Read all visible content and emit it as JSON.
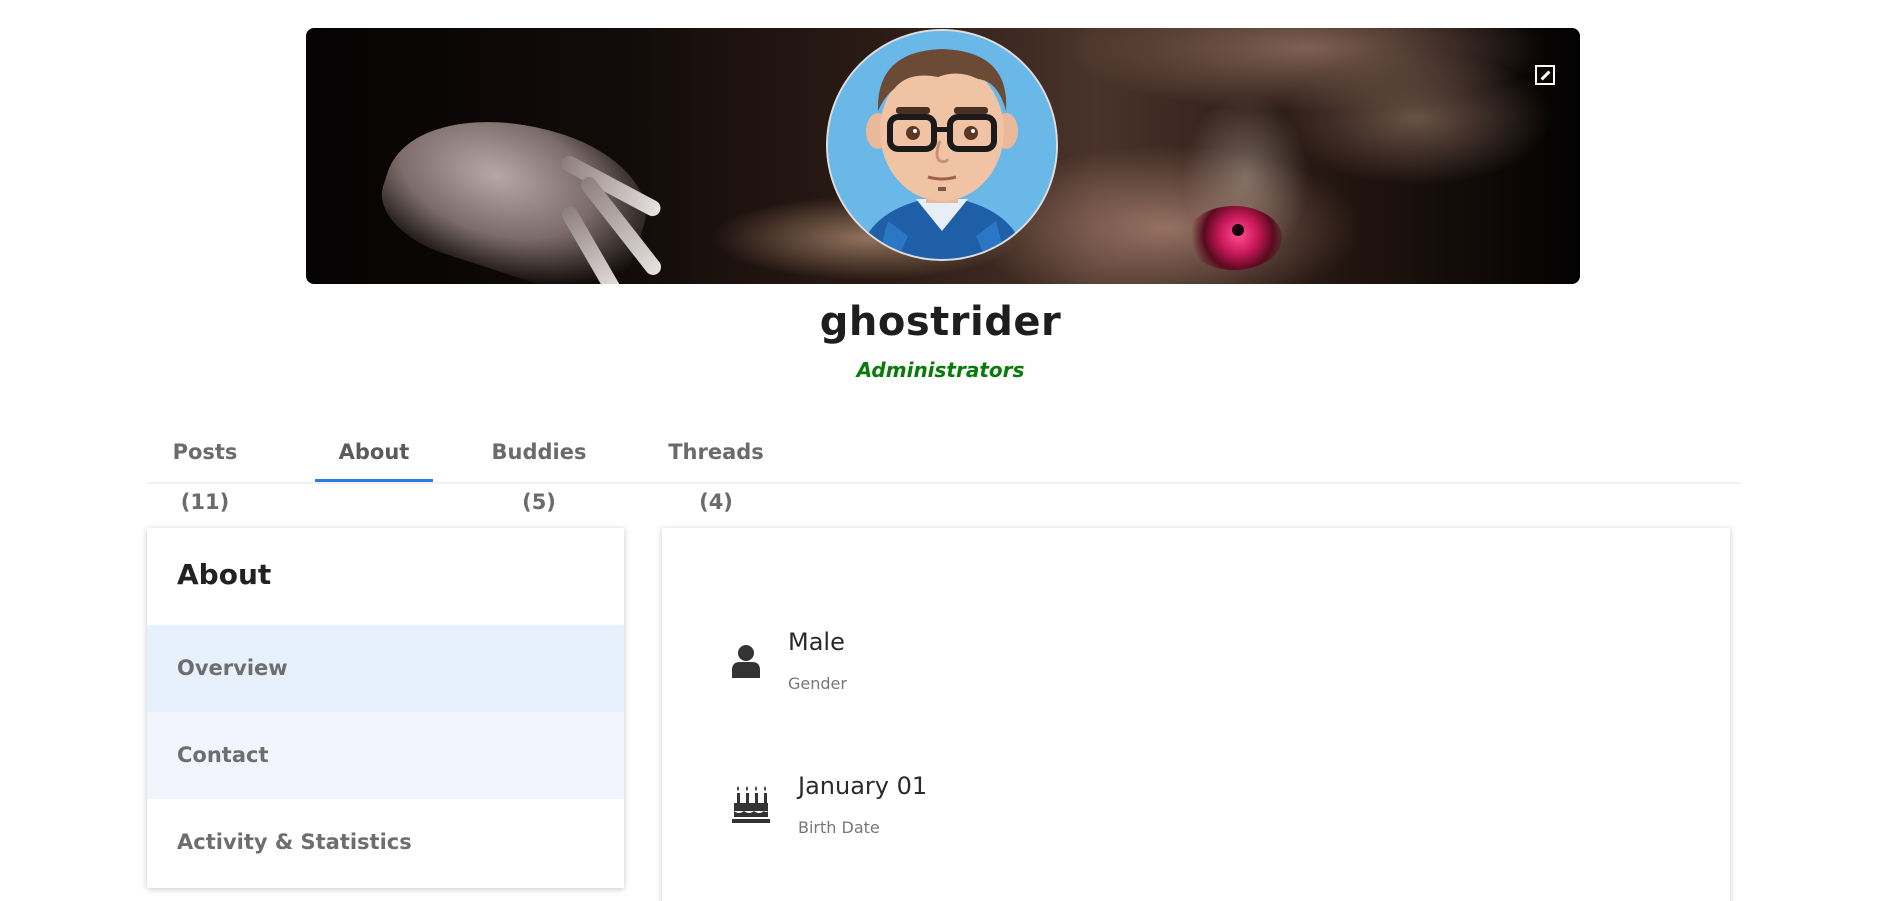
{
  "profile": {
    "username": "ghostrider",
    "usergroup": "Administrators",
    "usergroup_color": "#0a7a0a"
  },
  "cover": {
    "edit_icon": "edit-cover-icon"
  },
  "tabs": [
    {
      "label": "Posts (11)",
      "active": false
    },
    {
      "label": "About",
      "active": true
    },
    {
      "label": "Buddies (5)",
      "active": false
    },
    {
      "label": "Threads (4)",
      "active": false
    }
  ],
  "about_panel": {
    "title": "About",
    "items": [
      {
        "label": "Overview",
        "background": "#e6f1fd"
      },
      {
        "label": "Contact",
        "background": "#f3f4fd"
      },
      {
        "label": "Activity & Statistics",
        "background": "#ffffff"
      }
    ]
  },
  "details": [
    {
      "icon": "user-icon",
      "value": "Male",
      "label": "Gender"
    },
    {
      "icon": "birthday-cake-icon",
      "value": "January 01",
      "label": "Birth Date"
    }
  ],
  "colors": {
    "accent": "#2d7de0",
    "text": "#1e1e1e",
    "muted": "#6e6e6e"
  }
}
